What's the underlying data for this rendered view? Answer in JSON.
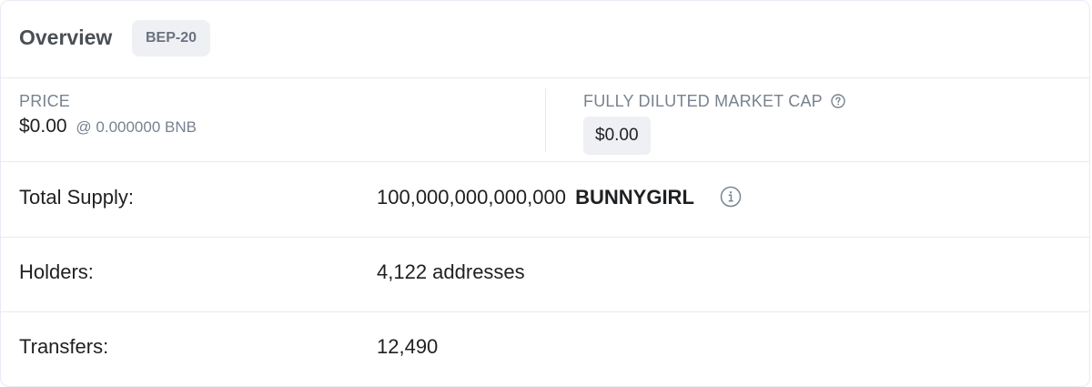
{
  "header": {
    "title": "Overview",
    "badge": "BEP-20"
  },
  "price": {
    "label": "PRICE",
    "value": "$0.00",
    "bnb": "@ 0.000000 BNB"
  },
  "fdmc": {
    "label": "FULLY DILUTED MARKET CAP",
    "value": "$0.00",
    "help_icon": "question-circle-icon"
  },
  "rows": {
    "supply": {
      "label": "Total Supply:",
      "amount": "100,000,000,000,000",
      "symbol": "BUNNYGIRL",
      "info_icon": "info-circle-icon"
    },
    "holders": {
      "label": "Holders:",
      "value": "4,122 addresses"
    },
    "transfers": {
      "label": "Transfers:",
      "value": "12,490"
    }
  },
  "colors": {
    "muted_text": "#77838f",
    "badge_bg": "#eef0f3",
    "border": "#e7eaf3",
    "text": "#1e2022"
  }
}
